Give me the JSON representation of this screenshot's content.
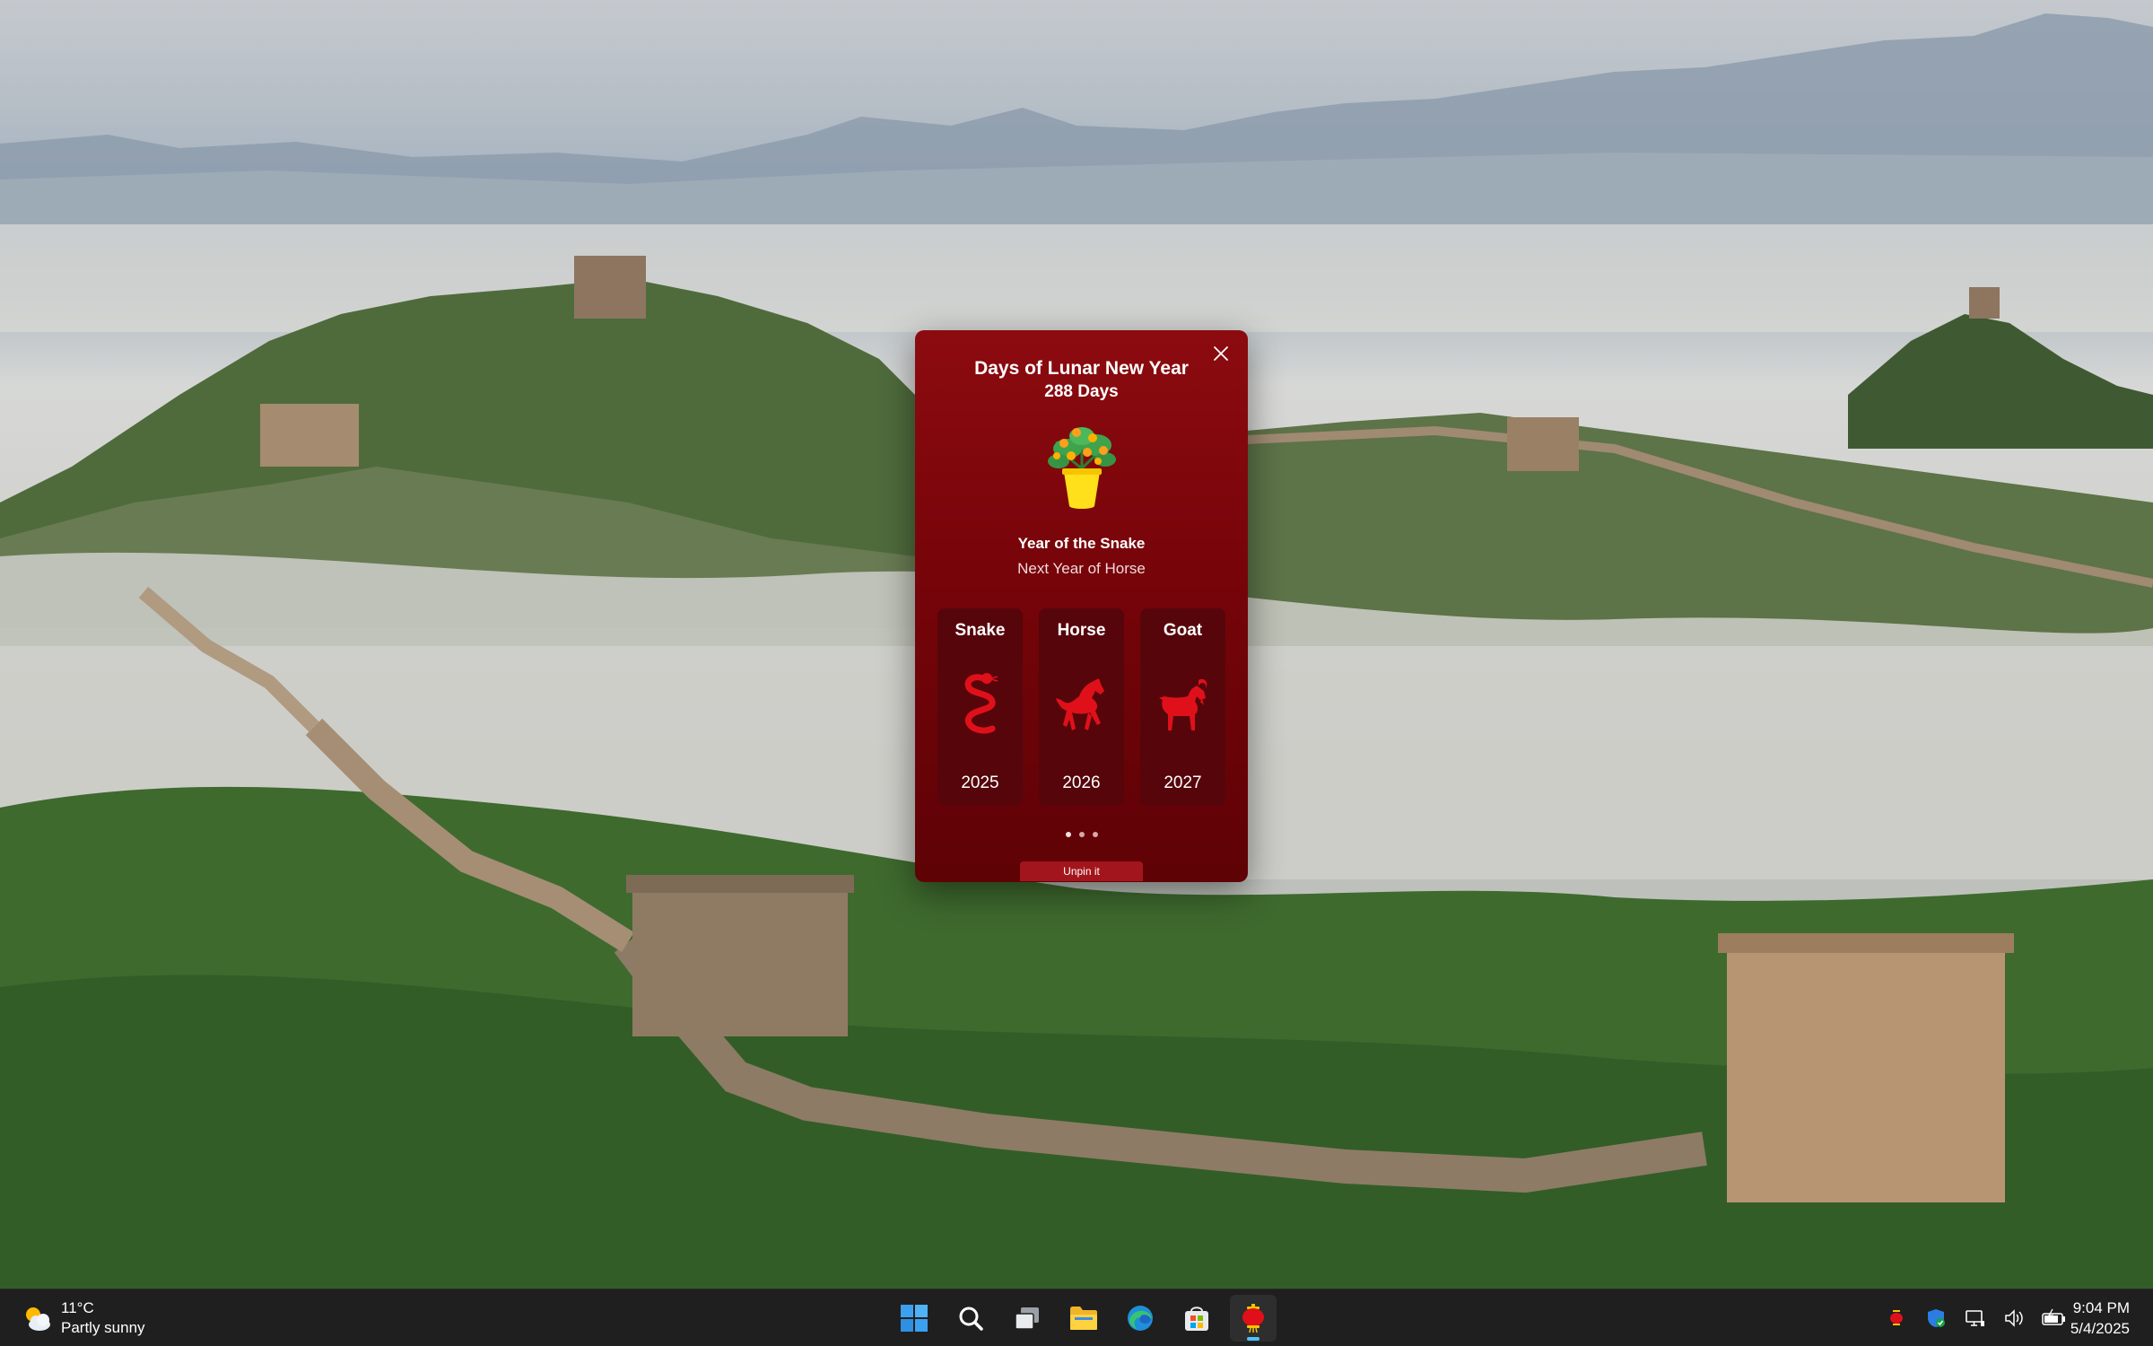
{
  "widget": {
    "title": "Days of Lunar New Year",
    "days": "288 Days",
    "current_year": "Year of the Snake",
    "next_year": "Next Year of Horse",
    "cards": [
      {
        "name": "Snake",
        "year": "2025",
        "icon": "snake-icon"
      },
      {
        "name": "Horse",
        "year": "2026",
        "icon": "horse-icon"
      },
      {
        "name": "Goat",
        "year": "2027",
        "icon": "goat-icon"
      }
    ],
    "page_dots": {
      "count": 3,
      "active": 1
    },
    "unpin_label": "Unpin it",
    "colors": {
      "background": "#7a0509",
      "card": "#56060b",
      "icon": "#e0101a",
      "unpin": "#a3151c"
    }
  },
  "taskbar": {
    "weather": {
      "temp": "11°C",
      "condition": "Partly sunny",
      "icon": "partly-sunny-icon"
    },
    "apps": [
      {
        "name": "start",
        "icon": "windows-start-icon"
      },
      {
        "name": "search",
        "icon": "search-icon"
      },
      {
        "name": "task-view",
        "icon": "task-view-icon"
      },
      {
        "name": "file-explorer",
        "icon": "folder-icon"
      },
      {
        "name": "edge",
        "icon": "edge-icon"
      },
      {
        "name": "store",
        "icon": "store-icon"
      },
      {
        "name": "lunar-new-year",
        "icon": "lantern-icon",
        "active": true
      }
    ],
    "tray": [
      "lantern-icon",
      "security-shield-icon",
      "network-icon",
      "volume-icon",
      "battery-icon"
    ],
    "time": "9:04 PM",
    "date": "5/4/2025"
  }
}
